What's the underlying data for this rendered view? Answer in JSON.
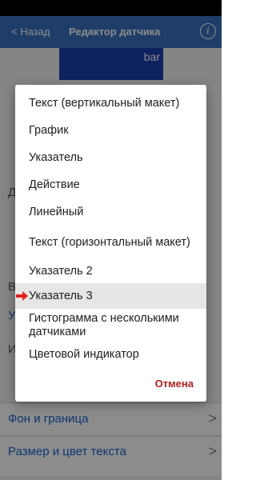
{
  "nav": {
    "back_label": "< Назад",
    "title": "Редактор датчика",
    "info_icon": "i"
  },
  "preview": {
    "text": "bar"
  },
  "background": {
    "section_d": "Д",
    "section_v": "В",
    "field_u": "У",
    "section_i": "И",
    "row_bg_border": "Фон и граница",
    "row_text_size_color": "Размер и цвет текста",
    "chevron": ">"
  },
  "dialog": {
    "options": [
      {
        "label": "Текст (вертикальный макет)"
      },
      {
        "label": "График"
      },
      {
        "label": "Указатель"
      },
      {
        "label": "Действие"
      },
      {
        "label": "Линейный"
      },
      {
        "label": "Текст (горизонтальный макет)"
      },
      {
        "label": "Указатель 2"
      },
      {
        "label": "Указатель 3",
        "selected": true
      },
      {
        "label": "Гистограмма с несколькими датчиками"
      },
      {
        "label": "Цветовой индикатор"
      }
    ],
    "cancel_label": "Отмена"
  },
  "colors": {
    "nav_bar": "#3a70c0",
    "preview_bg": "#1a3fae",
    "cancel": "#b01f1f",
    "selection_arrow": "#e02020",
    "selected_row": "#e6e6e6"
  },
  "icons": {
    "selection_marker": "right-arrow-icon"
  }
}
